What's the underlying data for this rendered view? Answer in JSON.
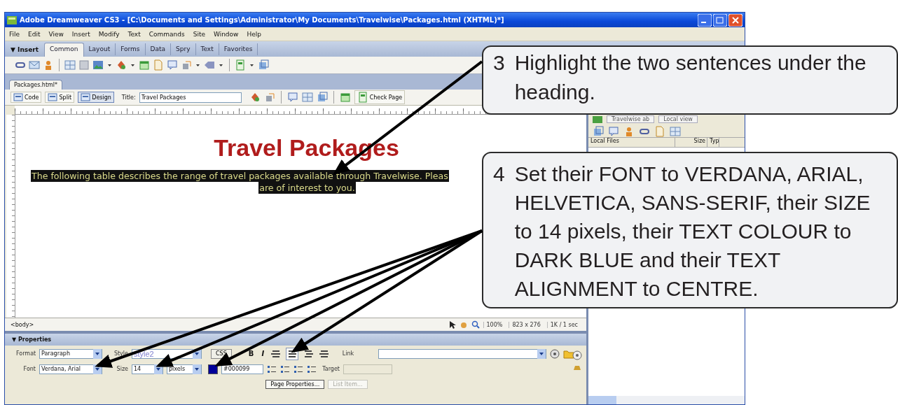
{
  "window": {
    "title": "Adobe Dreamweaver CS3 - [C:\\Documents and Settings\\Administrator\\My Documents\\Travelwise\\Packages.html (XHTML)*]"
  },
  "menu": [
    "File",
    "Edit",
    "View",
    "Insert",
    "Modify",
    "Text",
    "Commands",
    "Site",
    "Window",
    "Help"
  ],
  "insert_bar": {
    "label": "▼ Insert",
    "tabs": [
      {
        "label": "Common",
        "selected": true
      },
      {
        "label": "Layout",
        "selected": false
      },
      {
        "label": "Forms",
        "selected": false
      },
      {
        "label": "Data",
        "selected": false
      },
      {
        "label": "Spry",
        "selected": false
      },
      {
        "label": "Text",
        "selected": false
      },
      {
        "label": "Favorites",
        "selected": false
      }
    ]
  },
  "document": {
    "tab": "Packages.html*",
    "view_buttons": [
      {
        "label": "Code",
        "selected": false
      },
      {
        "label": "Split",
        "selected": false
      },
      {
        "label": "Design",
        "selected": true
      }
    ],
    "title_label": "Title:",
    "title_value": "Travel Packages",
    "check_page": "Check Page",
    "heading": "Travel Packages",
    "paragraph_lines": [
      "The following table describes the range of travel packages available through Travelwise. Pleas",
      "are of interest to you."
    ],
    "status": {
      "tag": "<body>",
      "zoom": "100%",
      "size": "823 x 276",
      "download": "1K / 1 sec"
    }
  },
  "properties": {
    "title": "▼ Properties",
    "format_label": "Format",
    "format": "Paragraph",
    "style_label": "Style",
    "style": "style2",
    "css": "CSS",
    "bold": "B",
    "italic": "I",
    "link_label": "Link",
    "font_label": "Font",
    "font": "Verdana, Arial",
    "size_label": "Size",
    "size": "14",
    "unit": "pixels",
    "color": "#000099",
    "target_label": "Target",
    "align": [
      {
        "selected": false
      },
      {
        "selected": true
      },
      {
        "selected": false
      },
      {
        "selected": false
      }
    ],
    "buttons": [
      {
        "label": "Page Properties...",
        "disabled": false
      },
      {
        "label": "List Item...",
        "disabled": true
      }
    ]
  },
  "files_panel": {
    "site": "Travelwise ab",
    "view": "Local view",
    "columns": [
      "Local Files",
      "Size",
      "Typ"
    ]
  },
  "callouts": [
    {
      "number": "3",
      "text": "Highlight the two sentences under the heading."
    },
    {
      "number": "4",
      "text": "Set their FONT to VERDANA, ARIAL, HELVETICA, SANS-SERIF, their SIZE to 14 pixels, their TEXT COLOUR to DARK BLUE and their TEXT ALIGNMENT to CENTRE."
    }
  ]
}
